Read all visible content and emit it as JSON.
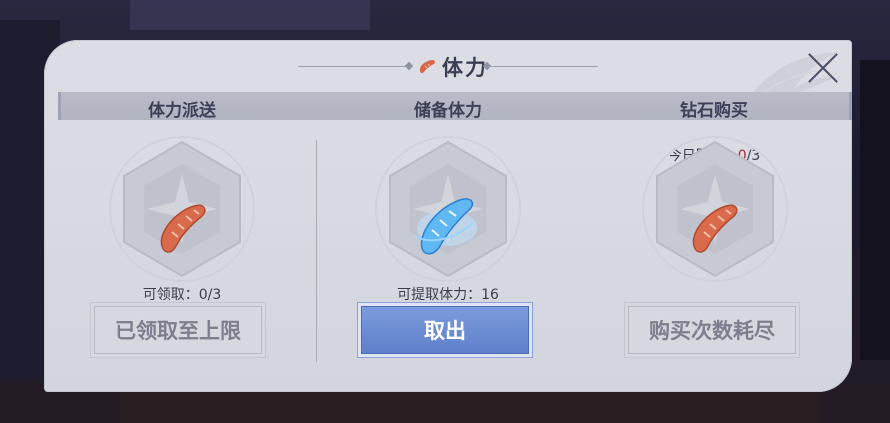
{
  "dialog": {
    "title": "体力",
    "columns": [
      {
        "title": "体力派送",
        "info_label": "可领取：0/3",
        "button_label": "已领取至上限",
        "button_state": "disabled",
        "item_icon": "sausage-icon"
      },
      {
        "title": "储备体力",
        "info_label": "可提取体力：16",
        "button_label": "取出",
        "button_state": "active",
        "item_icon": "crystal-sausage-icon"
      },
      {
        "title": "钻石购买",
        "limit_prefix": "今日限购：",
        "limit_used": "0",
        "limit_total": "/3",
        "button_label": "购买次数耗尽",
        "button_state": "disabled",
        "item_icon": "sausage-icon"
      }
    ]
  },
  "colors": {
    "panel_bg": "#d8d9e1",
    "header_bar": "#b5b8c4",
    "active_button": "#6a89d0",
    "limit_red": "#a23030",
    "title_text": "#3a3e55"
  }
}
